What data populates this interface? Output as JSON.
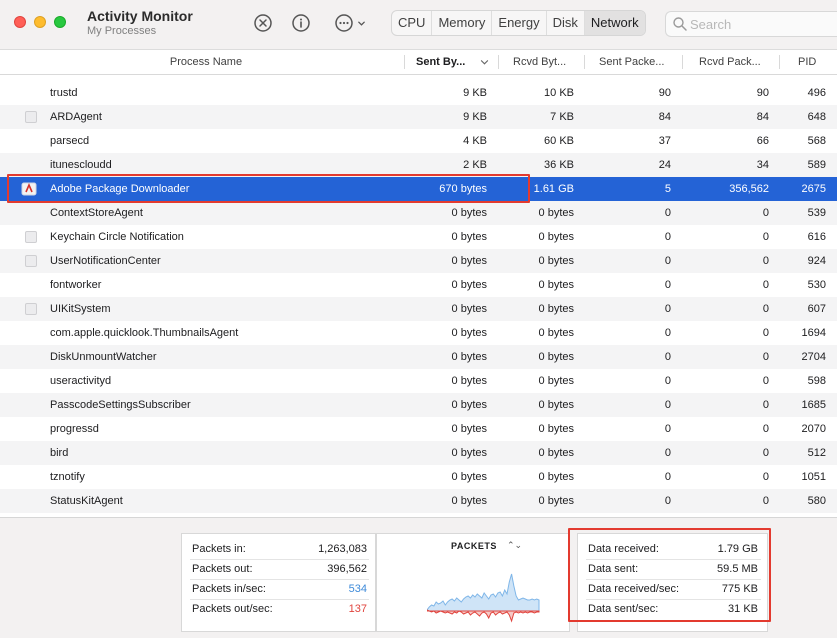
{
  "window": {
    "title": "Activity Monitor",
    "subtitle": "My Processes"
  },
  "tabs": [
    "CPU",
    "Memory",
    "Energy",
    "Disk",
    "Network"
  ],
  "active_tab": "Network",
  "search": {
    "placeholder": "Search",
    "value": ""
  },
  "columns": {
    "name": "Process Name",
    "sent_bytes": "Sent By...",
    "rcvd_bytes": "Rcvd Byt...",
    "sent_packets": "Sent Packe...",
    "rcvd_packets": "Rcvd Pack...",
    "pid": "PID"
  },
  "processes": [
    {
      "name": "trustd",
      "sent": "9 KB",
      "rcvd": "10 KB",
      "spk": "90",
      "rpk": "90",
      "pid": "496",
      "icon": "none"
    },
    {
      "name": "ARDAgent",
      "sent": "9 KB",
      "rcvd": "7 KB",
      "spk": "84",
      "rpk": "84",
      "pid": "648",
      "icon": "generic"
    },
    {
      "name": "parsecd",
      "sent": "4 KB",
      "rcvd": "60 KB",
      "spk": "37",
      "rpk": "66",
      "pid": "568",
      "icon": "none"
    },
    {
      "name": "itunescloudd",
      "sent": "2 KB",
      "rcvd": "36 KB",
      "spk": "24",
      "rpk": "34",
      "pid": "589",
      "icon": "none"
    },
    {
      "name": "Adobe Package Downloader",
      "sent": "670 bytes",
      "rcvd": "1.61 GB",
      "spk": "5",
      "rpk": "356,562",
      "pid": "2675",
      "icon": "adobe",
      "selected": true
    },
    {
      "name": "ContextStoreAgent",
      "sent": "0 bytes",
      "rcvd": "0 bytes",
      "spk": "0",
      "rpk": "0",
      "pid": "539",
      "icon": "none"
    },
    {
      "name": "Keychain Circle Notification",
      "sent": "0 bytes",
      "rcvd": "0 bytes",
      "spk": "0",
      "rpk": "0",
      "pid": "616",
      "icon": "generic"
    },
    {
      "name": "UserNotificationCenter",
      "sent": "0 bytes",
      "rcvd": "0 bytes",
      "spk": "0",
      "rpk": "0",
      "pid": "924",
      "icon": "generic"
    },
    {
      "name": "fontworker",
      "sent": "0 bytes",
      "rcvd": "0 bytes",
      "spk": "0",
      "rpk": "0",
      "pid": "530",
      "icon": "none"
    },
    {
      "name": "UIKitSystem",
      "sent": "0 bytes",
      "rcvd": "0 bytes",
      "spk": "0",
      "rpk": "0",
      "pid": "607",
      "icon": "generic"
    },
    {
      "name": "com.apple.quicklook.ThumbnailsAgent",
      "sent": "0 bytes",
      "rcvd": "0 bytes",
      "spk": "0",
      "rpk": "0",
      "pid": "1694",
      "icon": "none"
    },
    {
      "name": "DiskUnmountWatcher",
      "sent": "0 bytes",
      "rcvd": "0 bytes",
      "spk": "0",
      "rpk": "0",
      "pid": "2704",
      "icon": "none"
    },
    {
      "name": "useractivityd",
      "sent": "0 bytes",
      "rcvd": "0 bytes",
      "spk": "0",
      "rpk": "0",
      "pid": "598",
      "icon": "none"
    },
    {
      "name": "PasscodeSettingsSubscriber",
      "sent": "0 bytes",
      "rcvd": "0 bytes",
      "spk": "0",
      "rpk": "0",
      "pid": "1685",
      "icon": "none"
    },
    {
      "name": "progressd",
      "sent": "0 bytes",
      "rcvd": "0 bytes",
      "spk": "0",
      "rpk": "0",
      "pid": "2070",
      "icon": "none"
    },
    {
      "name": "bird",
      "sent": "0 bytes",
      "rcvd": "0 bytes",
      "spk": "0",
      "rpk": "0",
      "pid": "512",
      "icon": "none"
    },
    {
      "name": "tznotify",
      "sent": "0 bytes",
      "rcvd": "0 bytes",
      "spk": "0",
      "rpk": "0",
      "pid": "1051",
      "icon": "none"
    },
    {
      "name": "StatusKitAgent",
      "sent": "0 bytes",
      "rcvd": "0 bytes",
      "spk": "0",
      "rpk": "0",
      "pid": "580",
      "icon": "none"
    }
  ],
  "packets_stats": [
    {
      "label": "Packets in:",
      "value": "1,263,083",
      "color": "#1d1d1f"
    },
    {
      "label": "Packets out:",
      "value": "396,562",
      "color": "#1d1d1f"
    },
    {
      "label": "Packets in/sec:",
      "value": "534",
      "color": "#3d8ad9"
    },
    {
      "label": "Packets out/sec:",
      "value": "137",
      "color": "#e0443e"
    }
  ],
  "graph": {
    "title": "PACKETS",
    "in_color": "#7fb6e8",
    "out_color": "#e0443e"
  },
  "data_stats": [
    {
      "label": "Data received:",
      "value": "1.79 GB"
    },
    {
      "label": "Data sent:",
      "value": "59.5 MB"
    },
    {
      "label": "Data received/sec:",
      "value": "775 KB"
    },
    {
      "label": "Data sent/sec:",
      "value": "31 KB"
    }
  ],
  "colors": {
    "selection": "#2463d6",
    "highlight": "#e33a2f"
  }
}
